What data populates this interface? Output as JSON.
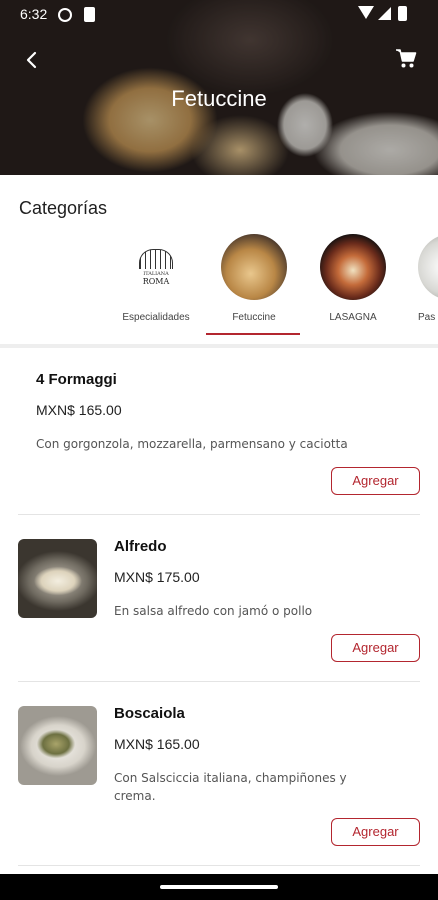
{
  "status_bar": {
    "time": "6:32"
  },
  "header": {
    "title": "Fetuccine"
  },
  "categories": {
    "title": "Categorías",
    "items": [
      {
        "label": "Especialidades"
      },
      {
        "label": "Fetuccine",
        "selected": true
      },
      {
        "label": "LASAGNA"
      },
      {
        "label": "Pas"
      }
    ],
    "logo_text": {
      "line1": "ITALIANA",
      "line2": "ROMA"
    }
  },
  "products": [
    {
      "name": "4 Formaggi",
      "price": "MXN$ 165.00",
      "description": "Con gorgonzola, mozzarella, parmensano y caciotta",
      "button": "Agregar"
    },
    {
      "name": "Alfredo",
      "price": "MXN$ 175.00",
      "description": "En salsa alfredo con jamó o pollo",
      "button": "Agregar"
    },
    {
      "name": "Boscaiola",
      "price": "MXN$ 165.00",
      "description": "Con Salsciccia italiana, champiñones y crema.",
      "button": "Agregar"
    }
  ],
  "colors": {
    "accent": "#b3262f",
    "text": "#222222",
    "muted": "#555555"
  },
  "icons": {
    "back": "arrow-back-icon",
    "cart": "shopping-cart-icon"
  }
}
